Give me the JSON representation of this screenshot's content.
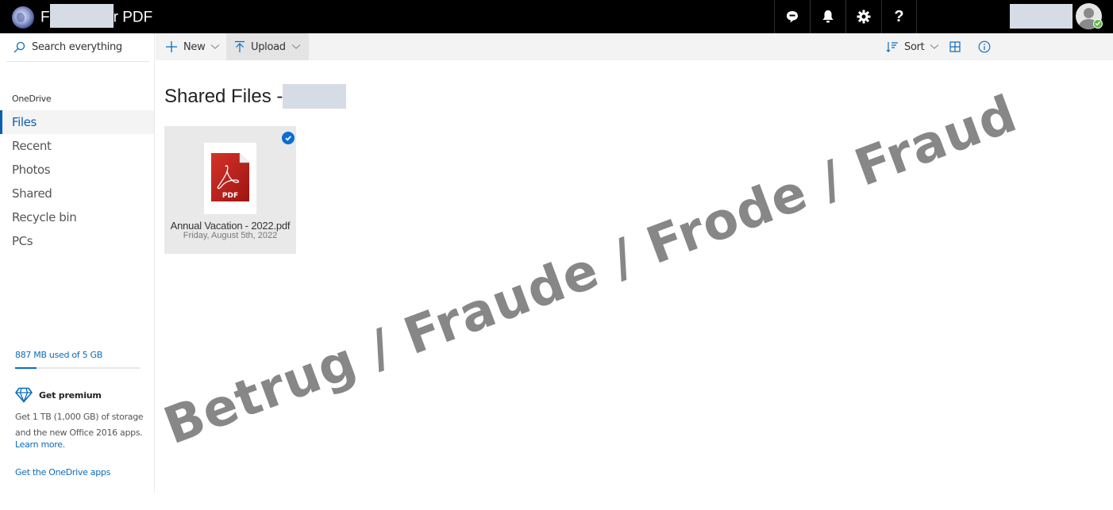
{
  "topbar": {
    "app_title_prefix": "F",
    "app_title_suffix": "r PDF",
    "icons": [
      "chat-icon",
      "bell-icon",
      "gear-icon",
      "help-icon"
    ],
    "help_glyph": "?"
  },
  "sidebar": {
    "search_placeholder": "Search everything",
    "section_heading": "OneDrive",
    "items": [
      {
        "label": "Files",
        "active": true
      },
      {
        "label": "Recent",
        "active": false
      },
      {
        "label": "Photos",
        "active": false
      },
      {
        "label": "Shared",
        "active": false
      },
      {
        "label": "Recycle bin",
        "active": false
      },
      {
        "label": "PCs",
        "active": false
      }
    ],
    "storage": {
      "text": "887 MB used of 5 GB",
      "used_fraction": 0.17
    },
    "premium": {
      "title": "Get premium",
      "description": "Get 1 TB (1,000 GB) of storage and the new Office 2016 apps.",
      "learn_more": "Learn more.",
      "get_apps": "Get the OneDrive apps"
    }
  },
  "commandbar": {
    "new_label": "New",
    "upload_label": "Upload",
    "sort_label": "Sort"
  },
  "main": {
    "title": "Shared Files -",
    "files": [
      {
        "name": "Annual Vacation - 2022.pdf",
        "date": "Friday, August 5th, 2022",
        "type": "pdf",
        "type_label": "PDF",
        "selected": true
      }
    ]
  },
  "watermark": "Betrug / Fraude / Frode / Fraud",
  "colors": {
    "accent": "#0b6cbd",
    "topbar": "#000000",
    "redaction": "#d6dce5",
    "watermark": "#878787",
    "pdf_red": "#c0221c"
  }
}
